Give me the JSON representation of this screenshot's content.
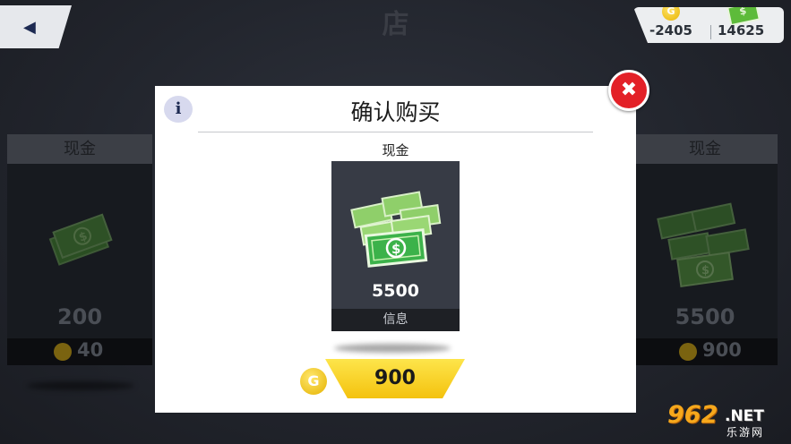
{
  "header": {
    "title": "店",
    "back_icon": "back-arrow-icon"
  },
  "currencies": {
    "gold_amount": "-2405",
    "gold_icon_glyph": "G",
    "cash_amount": "14625"
  },
  "background_cards": {
    "left": {
      "title": "现金",
      "amount": "200",
      "price": "40"
    },
    "right": {
      "title": "现金",
      "amount": "5500",
      "price": "900"
    }
  },
  "dialog": {
    "info_glyph": "i",
    "title": "确认购买",
    "item_label": "现金",
    "product": {
      "amount": "5500",
      "info_label": "信息"
    },
    "price": "900",
    "coin_glyph": "G",
    "close_glyph": "✖"
  },
  "watermark": {
    "number": "962",
    "suffix": ".NET",
    "chinese": "乐游网"
  },
  "colors": {
    "accent_yellow": "#f4c20e",
    "close_red": "#e32027",
    "cash_green": "#5dbb3a",
    "dialog_bg": "#ffffff",
    "card_bg": "#373b45"
  }
}
